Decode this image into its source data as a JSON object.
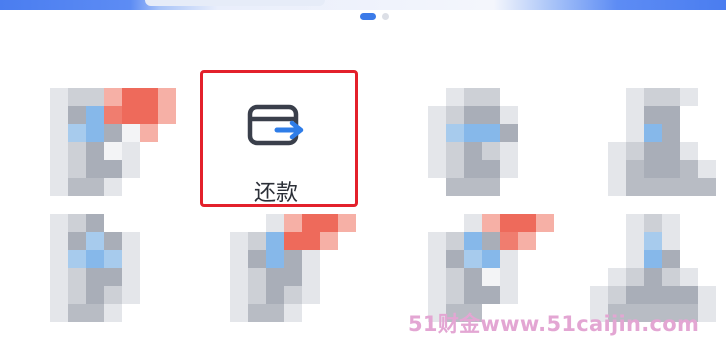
{
  "pagination": {
    "total_pages": 2,
    "active_page": 1
  },
  "repay_item": {
    "label": "还款",
    "icon": "card-repay-icon",
    "highlight_color": "#e3202b"
  },
  "watermark": {
    "text": "51财金www.51caijin.com"
  },
  "colors": {
    "accent": "#3c7be8",
    "banner": "#4a7df0"
  }
}
